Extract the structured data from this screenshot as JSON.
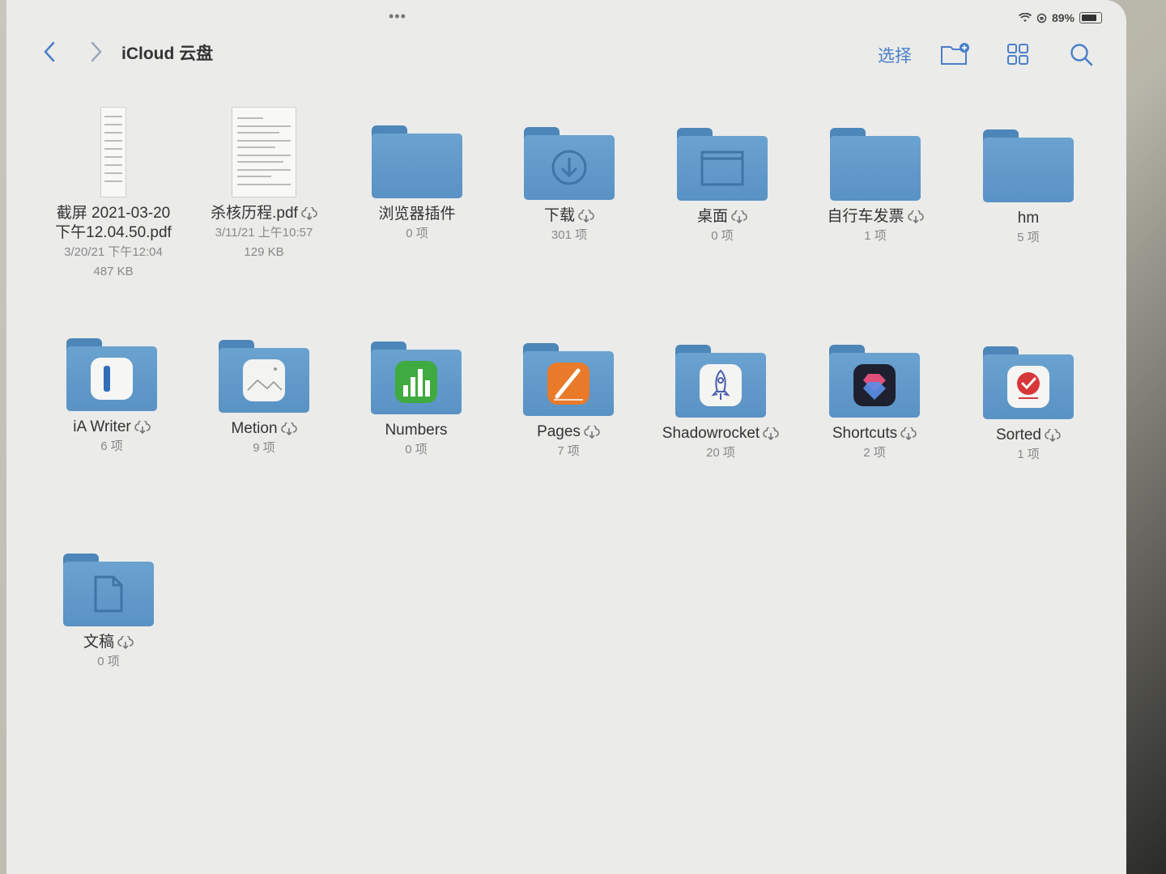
{
  "status": {
    "battery_percent": "89%"
  },
  "nav": {
    "title": "iCloud 云盘",
    "select_label": "选择"
  },
  "colors": {
    "accent": "#4a7fc9",
    "folder": "#6aa2d0"
  },
  "items": [
    {
      "name": "截屏 2021-03-20\n下午12.04.50.pdf",
      "line1": "截屏 2021-03-20",
      "line2": "下午12.04.50.pdf",
      "date": "3/20/21 下午12:04",
      "size": "487 KB",
      "type": "pdf",
      "icon": "document-thumbnail"
    },
    {
      "name": "杀核历程.pdf",
      "date": "3/11/21 上午10:57",
      "size": "129 KB",
      "type": "pdf",
      "icon": "document-thumbnail"
    },
    {
      "name": "浏览器插件",
      "count": "0 项",
      "type": "folder",
      "icon": "folder-icon"
    },
    {
      "name": "下载",
      "count": "301 项",
      "type": "folder",
      "icon": "download-folder-icon"
    },
    {
      "name": "桌面",
      "count": "0 项",
      "type": "folder",
      "icon": "desktop-folder-icon"
    },
    {
      "name": "自行车发票",
      "count": "1 项",
      "type": "folder",
      "icon": "folder-icon"
    },
    {
      "name": "hm",
      "count": "5 项",
      "type": "folder",
      "icon": "folder-icon"
    },
    {
      "name": "iA Writer",
      "count": "6 项",
      "type": "folder",
      "icon": "ia-writer-icon"
    },
    {
      "name": "Metion",
      "count": "9 项",
      "type": "folder",
      "icon": "image-icon"
    },
    {
      "name": "Numbers",
      "count": "0 项",
      "type": "folder",
      "icon": "numbers-icon"
    },
    {
      "name": "Pages",
      "count": "7 项",
      "type": "folder",
      "icon": "pages-icon"
    },
    {
      "name": "Shadowrocket",
      "count": "20 项",
      "type": "folder",
      "icon": "shadowrocket-icon"
    },
    {
      "name": "Shortcuts",
      "count": "2 项",
      "type": "folder",
      "icon": "shortcuts-icon"
    },
    {
      "name": "Sorted",
      "count": "1 项",
      "type": "folder",
      "icon": "sorted-icon"
    },
    {
      "name": "文稿",
      "count": "0 项",
      "type": "folder",
      "icon": "document-folder-icon"
    }
  ]
}
